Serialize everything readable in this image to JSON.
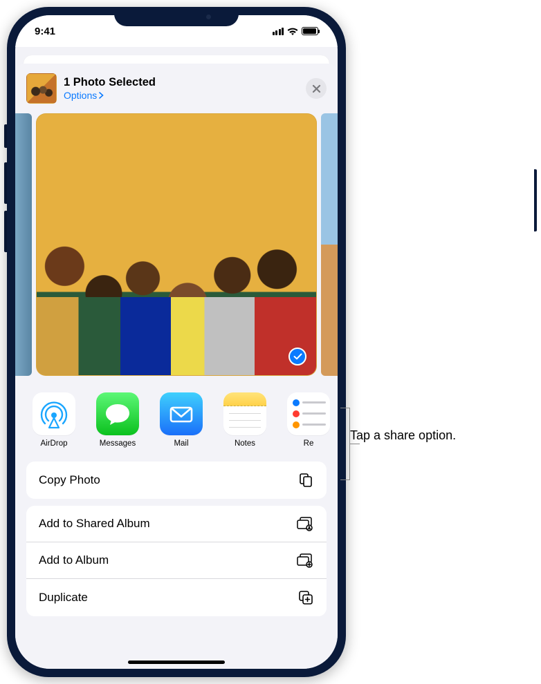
{
  "status": {
    "time": "9:41"
  },
  "sheet": {
    "title": "1 Photo Selected",
    "options_label": "Options",
    "close_name": "close"
  },
  "apps": [
    {
      "label": "AirDrop",
      "name": "airdrop-app"
    },
    {
      "label": "Messages",
      "name": "messages-app"
    },
    {
      "label": "Mail",
      "name": "mail-app"
    },
    {
      "label": "Notes",
      "name": "notes-app"
    },
    {
      "label": "Re",
      "name": "reminders-app"
    }
  ],
  "actions": {
    "copy": "Copy Photo",
    "shared": "Add to Shared Album",
    "album": "Add to Album",
    "duplicate": "Duplicate"
  },
  "callout": "Tap a share option."
}
